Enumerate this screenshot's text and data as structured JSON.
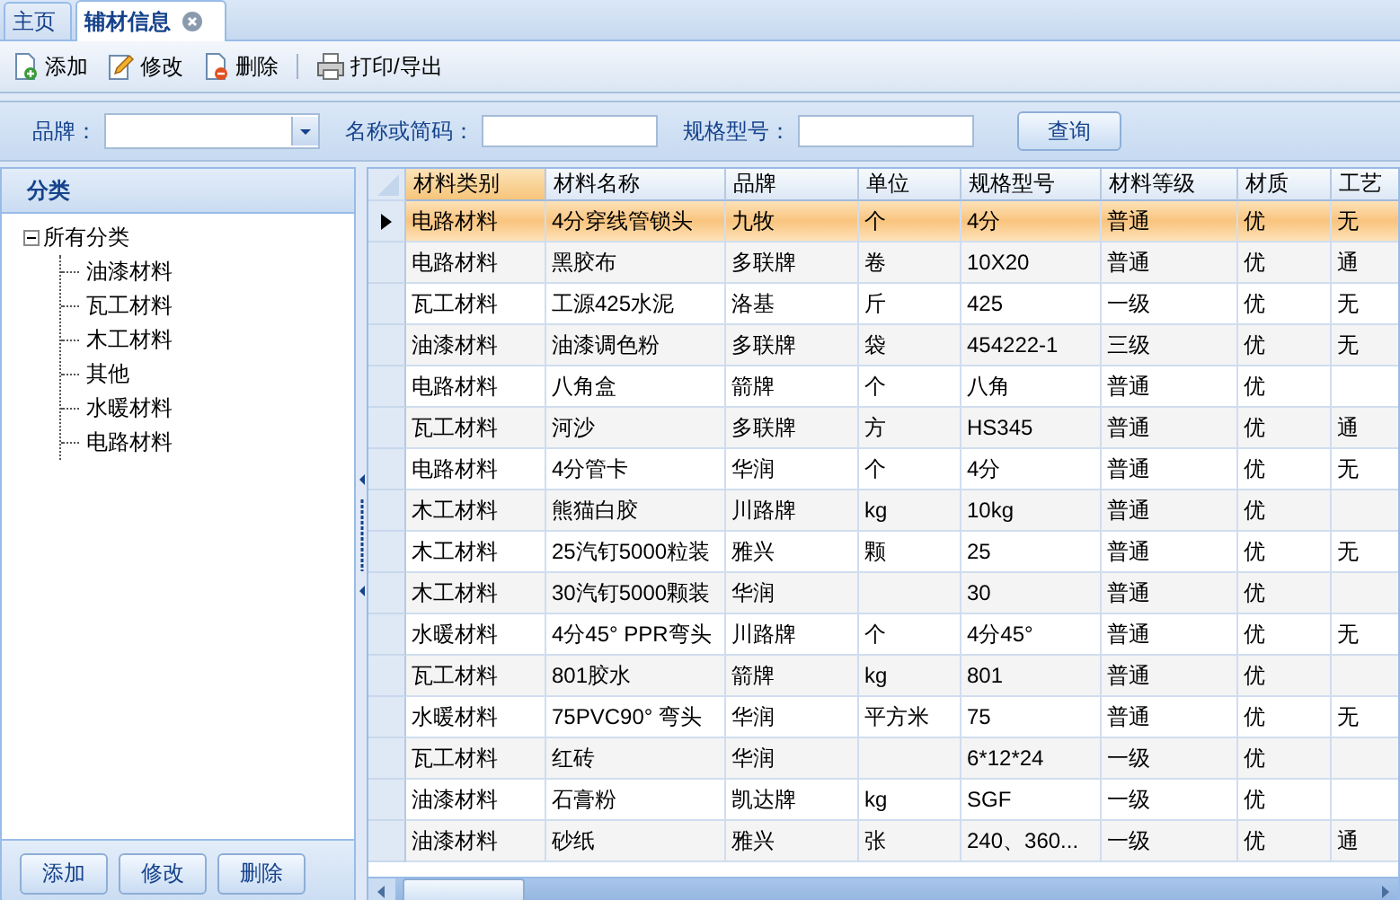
{
  "tabs": [
    {
      "label": "主页",
      "selected": false,
      "closable": false
    },
    {
      "label": "辅材信息",
      "selected": true,
      "closable": true
    }
  ],
  "toolbar": [
    {
      "kind": "add",
      "label": "添加"
    },
    {
      "kind": "edit",
      "label": "修改"
    },
    {
      "kind": "delete",
      "label": "删除"
    },
    {
      "kind": "separator"
    },
    {
      "kind": "print",
      "label": "打印/导出"
    }
  ],
  "filters": [
    {
      "kind": "combo",
      "label": "品牌："
    },
    {
      "kind": "text",
      "label": "名称或简码："
    },
    {
      "kind": "text",
      "label": "规格型号："
    }
  ],
  "search_button": "查询",
  "sidebar": {
    "title": "分类",
    "tree": [
      {
        "label": "所有分类",
        "expanded": true,
        "children": [
          {
            "label": "油漆材料"
          },
          {
            "label": "瓦工材料"
          },
          {
            "label": "木工材料"
          },
          {
            "label": "其他"
          },
          {
            "label": "水暖材料"
          },
          {
            "label": "电路材料"
          }
        ]
      }
    ],
    "buttons": [
      "添加",
      "修改",
      "删除"
    ]
  },
  "grid": {
    "columns": [
      {
        "label": "材料类别",
        "selected": true
      },
      {
        "label": "材料名称",
        "selected": false
      },
      {
        "label": "品牌",
        "selected": false
      },
      {
        "label": "单位",
        "selected": false
      },
      {
        "label": "规格型号",
        "selected": false
      },
      {
        "label": "材料等级",
        "selected": false
      },
      {
        "label": "材质",
        "selected": false
      },
      {
        "label": "工艺",
        "selected": false
      }
    ],
    "rows": [
      {
        "selected": true,
        "cells": [
          "电路材料",
          "4分穿线管锁头",
          "九牧",
          "个",
          "4分",
          "普通",
          "优",
          "无"
        ]
      },
      {
        "selected": false,
        "cells": [
          "电路材料",
          "黑胶布",
          "多联牌",
          "卷",
          "10X20",
          "普通",
          "优",
          "通"
        ]
      },
      {
        "selected": false,
        "cells": [
          "瓦工材料",
          "工源425水泥",
          "洛基",
          "斤",
          "425",
          "一级",
          "优",
          "无"
        ]
      },
      {
        "selected": false,
        "cells": [
          "油漆材料",
          "油漆调色粉",
          "多联牌",
          "袋",
          "454222-1",
          "三级",
          "优",
          "无"
        ]
      },
      {
        "selected": false,
        "cells": [
          "电路材料",
          "八角盒",
          "箭牌",
          "个",
          "八角",
          "普通",
          "优",
          ""
        ]
      },
      {
        "selected": false,
        "cells": [
          "瓦工材料",
          "河沙",
          "多联牌",
          "方",
          "HS345",
          "普通",
          "优",
          "通"
        ]
      },
      {
        "selected": false,
        "cells": [
          "电路材料",
          "4分管卡",
          "华润",
          "个",
          "4分",
          "普通",
          "优",
          "无"
        ]
      },
      {
        "selected": false,
        "cells": [
          "木工材料",
          "熊猫白胶",
          "川路牌",
          "kg",
          "10kg",
          "普通",
          "优",
          ""
        ]
      },
      {
        "selected": false,
        "cells": [
          "木工材料",
          "25汽钉5000粒装",
          "雅兴",
          "颗",
          "25",
          "普通",
          "优",
          "无"
        ]
      },
      {
        "selected": false,
        "cells": [
          "木工材料",
          "30汽钉5000颗装",
          "华润",
          "",
          "30",
          "普通",
          "优",
          ""
        ]
      },
      {
        "selected": false,
        "cells": [
          "水暖材料",
          "4分45° PPR弯头",
          "川路牌",
          "个",
          "4分45°",
          "普通",
          "优",
          "无"
        ]
      },
      {
        "selected": false,
        "cells": [
          "瓦工材料",
          "801胶水",
          "箭牌",
          "kg",
          "801",
          "普通",
          "优",
          ""
        ]
      },
      {
        "selected": false,
        "cells": [
          "水暖材料",
          "75PVC90° 弯头",
          "华润",
          "平方米",
          "75",
          "普通",
          "优",
          "无"
        ]
      },
      {
        "selected": false,
        "cells": [
          "瓦工材料",
          "红砖",
          "华润",
          "",
          "6*12*24",
          "一级",
          "优",
          ""
        ]
      },
      {
        "selected": false,
        "cells": [
          "油漆材料",
          "石膏粉",
          "凯达牌",
          "kg",
          "SGF",
          "一级",
          "优",
          ""
        ]
      },
      {
        "selected": false,
        "cells": [
          "油漆材料",
          "砂纸",
          "雅兴",
          "张",
          "240、360...",
          "一级",
          "优",
          "通"
        ]
      }
    ]
  }
}
